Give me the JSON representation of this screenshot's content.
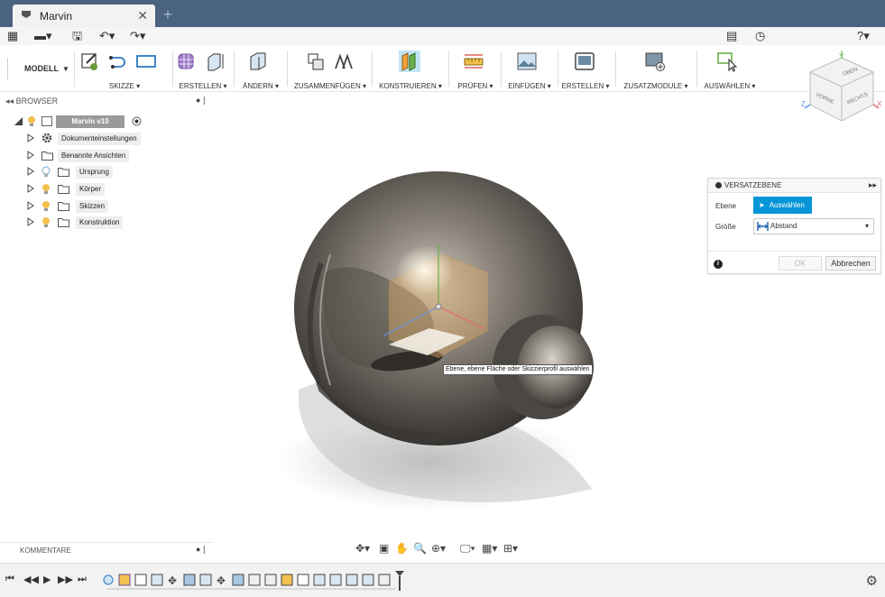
{
  "window": {
    "tab_title": "Marvin",
    "tab_close": "✕",
    "new_tab": "+"
  },
  "quick_access": {
    "grid": "▦",
    "file": "▬▾",
    "save": "🖫",
    "undo": "↶▾",
    "redo": "↷▾",
    "comments": "▤",
    "history": "◷",
    "help": "?▾"
  },
  "ribbon": {
    "mode_label": "MODELL",
    "mode_caret": "▼",
    "groups": [
      {
        "label": "SKIZZE ▾"
      },
      {
        "label": "ERSTELLEN ▾"
      },
      {
        "label": "ÄNDERN ▾"
      },
      {
        "label": "ZUSAMMENFÜGEN ▾"
      },
      {
        "label": "KONSTRUIEREN ▾"
      },
      {
        "label": "PRÜFEN ▾"
      },
      {
        "label": "EINFÜGEN ▾"
      },
      {
        "label": "ERSTELLEN ▾"
      },
      {
        "label": "ZUSATZMODULE ▾"
      },
      {
        "label": "AUSWÄHLEN ▾"
      }
    ]
  },
  "viewcube": {
    "top": "OBEN",
    "front": "VORNE",
    "right": "RECHTS",
    "axis_x": "X",
    "axis_y": "Y",
    "axis_z": "Z"
  },
  "browser": {
    "collapse": "◂◂",
    "title": "BROWSER",
    "root": "Marvin v10",
    "items": [
      {
        "label": "Dokumenteinstellungen",
        "icon": "gear-icon"
      },
      {
        "label": "Benannte Ansichten",
        "icon": "folder-icon"
      },
      {
        "label": "Ursprung",
        "icon": "folder-icon"
      },
      {
        "label": "Körper",
        "icon": "folder-icon"
      },
      {
        "label": "Skizzen",
        "icon": "folder-icon"
      },
      {
        "label": "Konstruktion",
        "icon": "folder-icon"
      }
    ]
  },
  "offset_plane_panel": {
    "title": "VERSATZEBENE",
    "expand": "▸▸",
    "plane_label": "Ebene",
    "select_button": "Auswählen",
    "size_label": "Größe",
    "size_value": "Abstand",
    "ok": "OK",
    "cancel": "Abbrechen",
    "accent_color": "#0696d7"
  },
  "tooltip": "Ebene, ebene Fläche oder Skizzierprofil auswählen",
  "comments": {
    "title": "KOMMENTARE"
  },
  "nav_toolbar": {
    "orbit": "✥▾",
    "look": "▣",
    "pan": "✋",
    "zoom": "🔍",
    "fit": "⊕▾",
    "display": "🖵▾",
    "grid": "▦▾",
    "viewports": "⊞▾"
  },
  "timeline": {
    "first": "⏮",
    "prev": "◀◀",
    "play": "▶",
    "next": "▶▶",
    "last": "⏭",
    "settings": "⚙"
  }
}
